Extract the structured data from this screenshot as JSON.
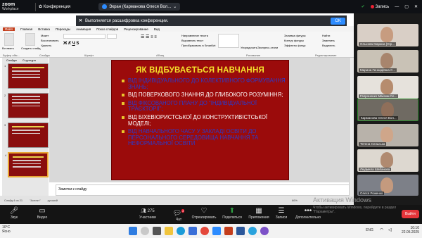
{
  "zoom": {
    "brand": "zoom",
    "product": "Workplace",
    "conference": "Конференция",
    "screen_pill": "Экран (Карманова Олеся Вол...",
    "recording": "Запись"
  },
  "banner": {
    "text": "Выполняется расшифровка конференции.",
    "ok": "OK"
  },
  "ppt": {
    "tabs": [
      "Файл",
      "Главная",
      "Вставка",
      "Переходы",
      "Анимация",
      "Показ слайдов",
      "Рецензирование",
      "Вид"
    ],
    "groups": [
      "Буфер обм...",
      "Слайды",
      "Шрифт",
      "Абзац",
      "Рисование",
      "Редактирование"
    ],
    "buttons": {
      "paste": "Вставить",
      "new_slide": "Создать слайд",
      "layout": "Макет",
      "reset": "Восстановить",
      "delete": "Удалить",
      "arrange": "Упорядочить",
      "quick_styles": "Экспресс-стили",
      "fill": "Заливка фигуры",
      "outline": "Контур фигуры",
      "effects": "Эффекты фигур",
      "find": "Найти",
      "replace": "Заменить",
      "select": "Выделить",
      "text_dir": "Направление текста",
      "align_text": "Выровнять текст",
      "smartart": "Преобразовать в SmartArt"
    },
    "panel_tabs": [
      "Слайды",
      "Структура"
    ],
    "thumbs": [
      "1",
      "2",
      "3",
      "4"
    ],
    "notes": "Заметки к слайду",
    "status": [
      "Слайд 4 из 21",
      "\"Аспект\"",
      "русский"
    ],
    "zoom_level": "66%"
  },
  "slide": {
    "title": "ЯК ВІДБУВАЄТЬСЯ НАВЧАННЯ",
    "bullets": [
      {
        "text": "ВІД ІНДИВІДУАЛЬНОГО ДО КОЛЕКТИВНОГО ФОРМУВАННЯ ЗНАНЬ;",
        "color": "blue"
      },
      {
        "text": "ВІД ПОВЕРХОВОГО ЗНАННЯ ДО ГЛИБОКОГО РОЗУМІННЯ;",
        "color": "white"
      },
      {
        "text": "ВІД ФІКСОВАНОГО ПЛАНУ ДО \"ІНДИВІДУАЛЬНОЇ ТРАЄКТОРІЇ\";",
        "color": "blue"
      },
      {
        "text": "ВІД БІХЕВІОРИСТСЬКОЇ ДО КОНСТРУКТИВІСТСЬКОЇ МОДЕЛІ;",
        "color": "white"
      },
      {
        "text": "ВІД НАВЧАЛЬНОГО ЧАСУ У ЗАКЛАДІ ОСВІТИ ДО ПЕРСОНАЛЬНОГО СЕРЕДОВИЩА НАВЧАННЯ ТА НЕФОРМАЛЬНОЇ ОСВІТИ",
        "color": "blue"
      }
    ]
  },
  "participants": [
    "Ольхова Марина (Юр...",
    "Марина Геннадіївна С...",
    "Гапроненко Максим Се...",
    "Карманова Олеся Вол...",
    "Тетяна Сельська",
    "Людмила Шабанова",
    "Олеся Роженко"
  ],
  "controls": {
    "audio": "Звук",
    "video": "Видео",
    "participants": "Участники",
    "participants_count": "275",
    "chat": "Чат",
    "chat_badge": "2",
    "react": "Отреагировать",
    "share": "Поделиться",
    "apps": "Приложения",
    "notes": "Записи",
    "more": "Дополнительно",
    "leave": "Выйти"
  },
  "watermark": {
    "title": "Активация Windows",
    "text": "Чтобы активировать Windows, перейдите в раздел \"Параметры\"."
  },
  "taskbar": {
    "temp": "10°C",
    "weather": "Ясно",
    "lang": "ENG",
    "time": "10:10",
    "date": "22.05.2025"
  }
}
